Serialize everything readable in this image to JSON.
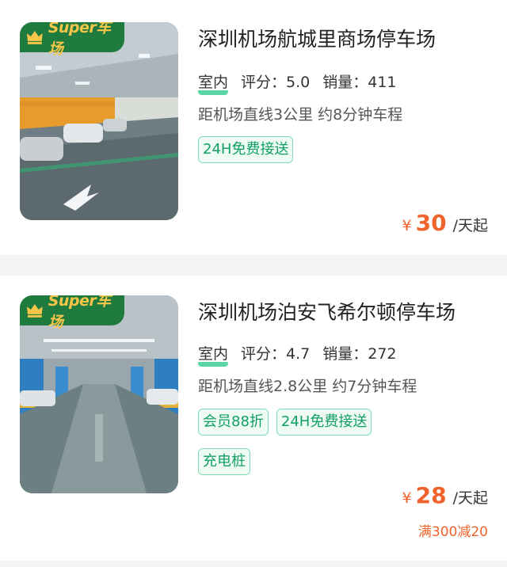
{
  "listings": [
    {
      "badge": "Super车场",
      "title": "深圳机场航城里商场停车场",
      "indoor": "室内",
      "rating": "评分：5.0",
      "sales": "销量：411",
      "distance": "距机场直线3公里 约8分钟车程",
      "tags": [
        "24H免费接送"
      ],
      "currency": "¥",
      "price": "30",
      "unit": "/天起"
    },
    {
      "badge": "Super车场",
      "title": "深圳机场泊安飞希尔顿停车场",
      "indoor": "室内",
      "rating": "评分：4.7",
      "sales": "销量：272",
      "distance": "距机场直线2.8公里 约7分钟车程",
      "tags": [
        "会员88折",
        "24H免费接送",
        "充电桩"
      ],
      "currency": "¥",
      "price": "28",
      "unit": "/天起",
      "promo": "满300减20"
    }
  ],
  "colors": {
    "accent_green": "#13a063",
    "badge_bg": "#1f7a3e",
    "badge_text": "#f6c64a",
    "price": "#f0632d"
  }
}
